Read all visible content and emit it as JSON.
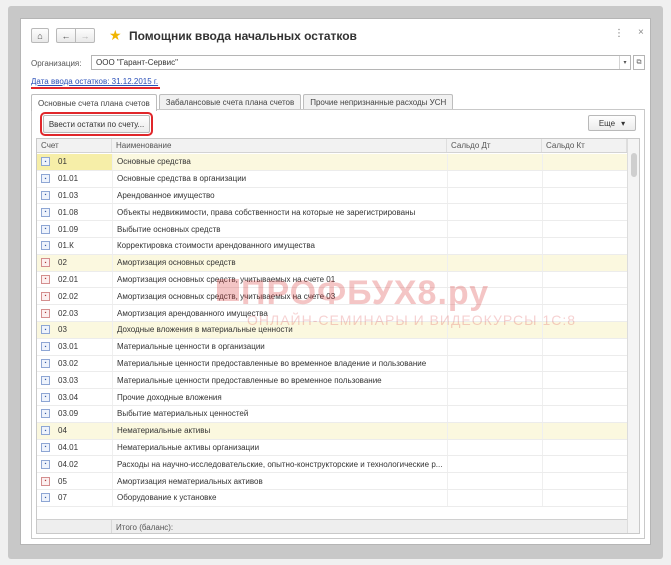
{
  "window": {
    "title": "Помощник ввода начальных остатков",
    "nav": {
      "home_icon": "⌂",
      "back_icon": "←",
      "forward_icon": "→",
      "star_icon": "★",
      "menu_icon": "⋮",
      "close_icon": "×"
    }
  },
  "organization": {
    "label": "Организация:",
    "value": "ООО \"Гарант-Сервис\"",
    "dropdown_icon": "▾",
    "open_icon": "⧉"
  },
  "date_link": "Дата ввода остатков: 31.12.2015 г.",
  "tabs": [
    {
      "label": "Основные счета плана счетов",
      "active": true
    },
    {
      "label": "Забалансовые счета плана счетов",
      "active": false
    },
    {
      "label": "Прочие непризнанные расходы УСН",
      "active": false
    }
  ],
  "toolbar": {
    "enter_button": "Ввести остатки по счету...",
    "more_button": "Еще",
    "more_icon": "▾"
  },
  "table": {
    "columns": [
      "Счет",
      "Наименование",
      "Сальдо Дт",
      "Сальдо Кт"
    ],
    "rows": [
      {
        "account": "01",
        "name": "Основные средства",
        "group": true,
        "icon": "blue",
        "selected": true
      },
      {
        "account": "01.01",
        "name": "Основные средства в организации",
        "group": false,
        "icon": "blue"
      },
      {
        "account": "01.03",
        "name": "Арендованное имущество",
        "group": false,
        "icon": "blue"
      },
      {
        "account": "01.08",
        "name": "Объекты недвижимости, права собственности на которые не зарегистрированы",
        "group": false,
        "icon": "blue"
      },
      {
        "account": "01.09",
        "name": "Выбытие основных средств",
        "group": false,
        "icon": "blue"
      },
      {
        "account": "01.К",
        "name": "Корректировка стоимости арендованного имущества",
        "group": false,
        "icon": "blue"
      },
      {
        "account": "02",
        "name": "Амортизация основных средств",
        "group": true,
        "icon": "red"
      },
      {
        "account": "02.01",
        "name": "Амортизация основных средств, учитываемых на счете 01",
        "group": false,
        "icon": "red"
      },
      {
        "account": "02.02",
        "name": "Амортизация основных средств, учитываемых на счете 03",
        "group": false,
        "icon": "red"
      },
      {
        "account": "02.03",
        "name": "Амортизация арендованного имущества",
        "group": false,
        "icon": "red"
      },
      {
        "account": "03",
        "name": "Доходные вложения в материальные ценности",
        "group": true,
        "icon": "blue"
      },
      {
        "account": "03.01",
        "name": "Материальные ценности в организации",
        "group": false,
        "icon": "blue"
      },
      {
        "account": "03.02",
        "name": "Материальные ценности предоставленные во временное владение и пользование",
        "group": false,
        "icon": "blue"
      },
      {
        "account": "03.03",
        "name": "Материальные ценности предоставленные во временное пользование",
        "group": false,
        "icon": "blue"
      },
      {
        "account": "03.04",
        "name": "Прочие доходные вложения",
        "group": false,
        "icon": "blue"
      },
      {
        "account": "03.09",
        "name": "Выбытие материальных ценностей",
        "group": false,
        "icon": "blue"
      },
      {
        "account": "04",
        "name": "Нематериальные активы",
        "group": true,
        "icon": "blue"
      },
      {
        "account": "04.01",
        "name": "Нематериальные активы организации",
        "group": false,
        "icon": "blue"
      },
      {
        "account": "04.02",
        "name": "Расходы на научно-исследовательские, опытно-конструкторские и технологические р...",
        "group": false,
        "icon": "blue"
      },
      {
        "account": "05",
        "name": "Амортизация нематериальных активов",
        "group": false,
        "icon": "red"
      },
      {
        "account": "07",
        "name": "Оборудование к установке",
        "group": false,
        "icon": "blue"
      }
    ],
    "footer_label": "Итого (баланс):"
  },
  "watermark": {
    "line1": "ПРОФБУХ8.ру",
    "line2": "ОНЛАЙН-СЕМИНАРЫ И ВИДЕОКУРСЫ 1С:8"
  }
}
